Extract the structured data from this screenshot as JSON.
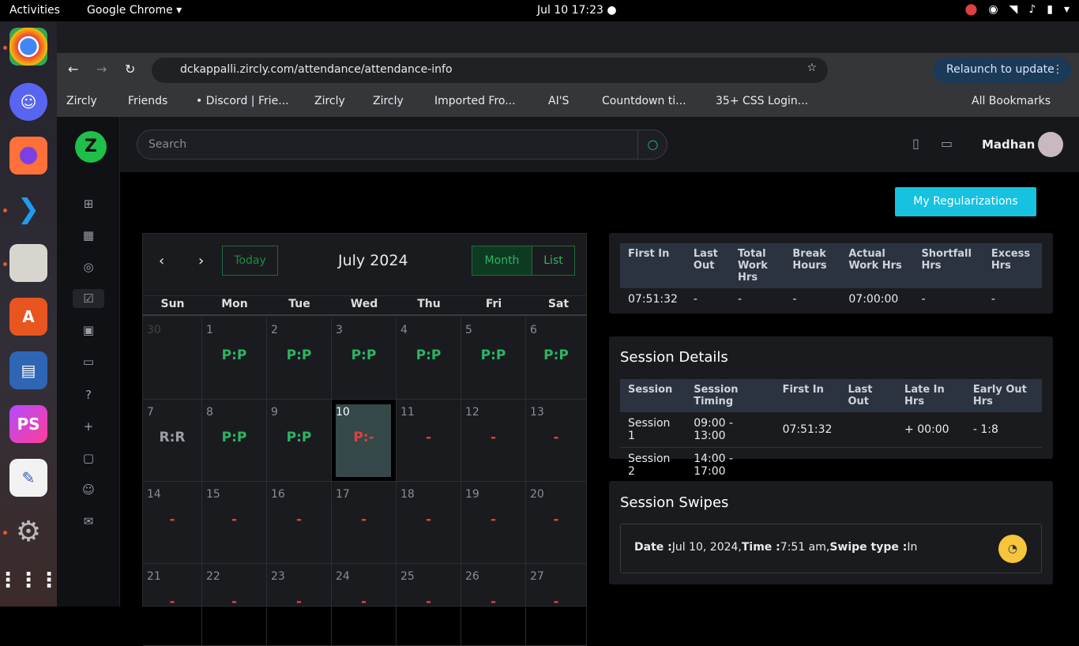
{
  "topbar": {
    "activities": "Activities",
    "app": "Google Chrome ▾",
    "clock": "Jul 10  17:23  ●"
  },
  "browser": {
    "url": "dckappalli.zircly.com/attendance/attendance-info",
    "relaunch": "Relaunch to update",
    "bookmarks": [
      "Zircly",
      "Friends",
      "• Discord | Frie...",
      "Zircly",
      "Zircly",
      "Imported Fro...",
      "AI'S",
      "Countdown ti...",
      "35+ CSS Login..."
    ],
    "all_bookmarks": "All Bookmarks"
  },
  "header": {
    "search_placeholder": "Search",
    "user": "Madhan"
  },
  "main": {
    "reg_button": "My Regularizations"
  },
  "calendar": {
    "title": "July 2024",
    "today": "Today",
    "month": "Month",
    "list": "List",
    "days": [
      "Sun",
      "Mon",
      "Tue",
      "Wed",
      "Thu",
      "Fri",
      "Sat"
    ],
    "cells": [
      [
        "30",
        ""
      ],
      [
        "1",
        "P:P"
      ],
      [
        "2",
        "P:P"
      ],
      [
        "3",
        "P:P"
      ],
      [
        "4",
        "P:P"
      ],
      [
        "5",
        "P:P"
      ],
      [
        "6",
        "P:P"
      ],
      [
        "7",
        "R:R"
      ],
      [
        "8",
        "P:P"
      ],
      [
        "9",
        "P:P"
      ],
      [
        "10",
        "P:-"
      ],
      [
        "11",
        "-"
      ],
      [
        "12",
        "-"
      ],
      [
        "13",
        "-"
      ],
      [
        "14",
        "-"
      ],
      [
        "15",
        "-"
      ],
      [
        "16",
        "-"
      ],
      [
        "17",
        "-"
      ],
      [
        "18",
        "-"
      ],
      [
        "19",
        "-"
      ],
      [
        "20",
        "-"
      ],
      [
        "21",
        "-"
      ],
      [
        "22",
        "-"
      ],
      [
        "23",
        "-"
      ],
      [
        "24",
        "-"
      ],
      [
        "25",
        "-"
      ],
      [
        "26",
        "-"
      ],
      [
        "27",
        "-"
      ]
    ]
  },
  "summary": {
    "headers": [
      "First In",
      "Last Out",
      "Total Work Hrs",
      "Break Hours",
      "Actual Work Hrs",
      "Shortfall Hrs",
      "Excess Hrs"
    ],
    "row": [
      "07:51:32",
      "-",
      "-",
      "-",
      "07:00:00",
      "-",
      "-"
    ]
  },
  "sessions": {
    "title": "Session Details",
    "headers": [
      "Session",
      "Session Timing",
      "First In",
      "Last Out",
      "Late In Hrs",
      "Early Out Hrs"
    ],
    "rows": [
      [
        "Session 1",
        "09:00 - 13:00",
        "07:51:32",
        "",
        "+ 00:00",
        "- 1:8"
      ],
      [
        "Session 2",
        "14:00 - 17:00",
        "",
        "",
        "",
        ""
      ]
    ]
  },
  "swipes": {
    "title": "Session Swipes",
    "date_label": "Date :",
    "date": "Jul 10, 2024,",
    "time_label": "Time :",
    "time": "7:51 am,",
    "type_label": "Swipe type :",
    "type": "In"
  }
}
